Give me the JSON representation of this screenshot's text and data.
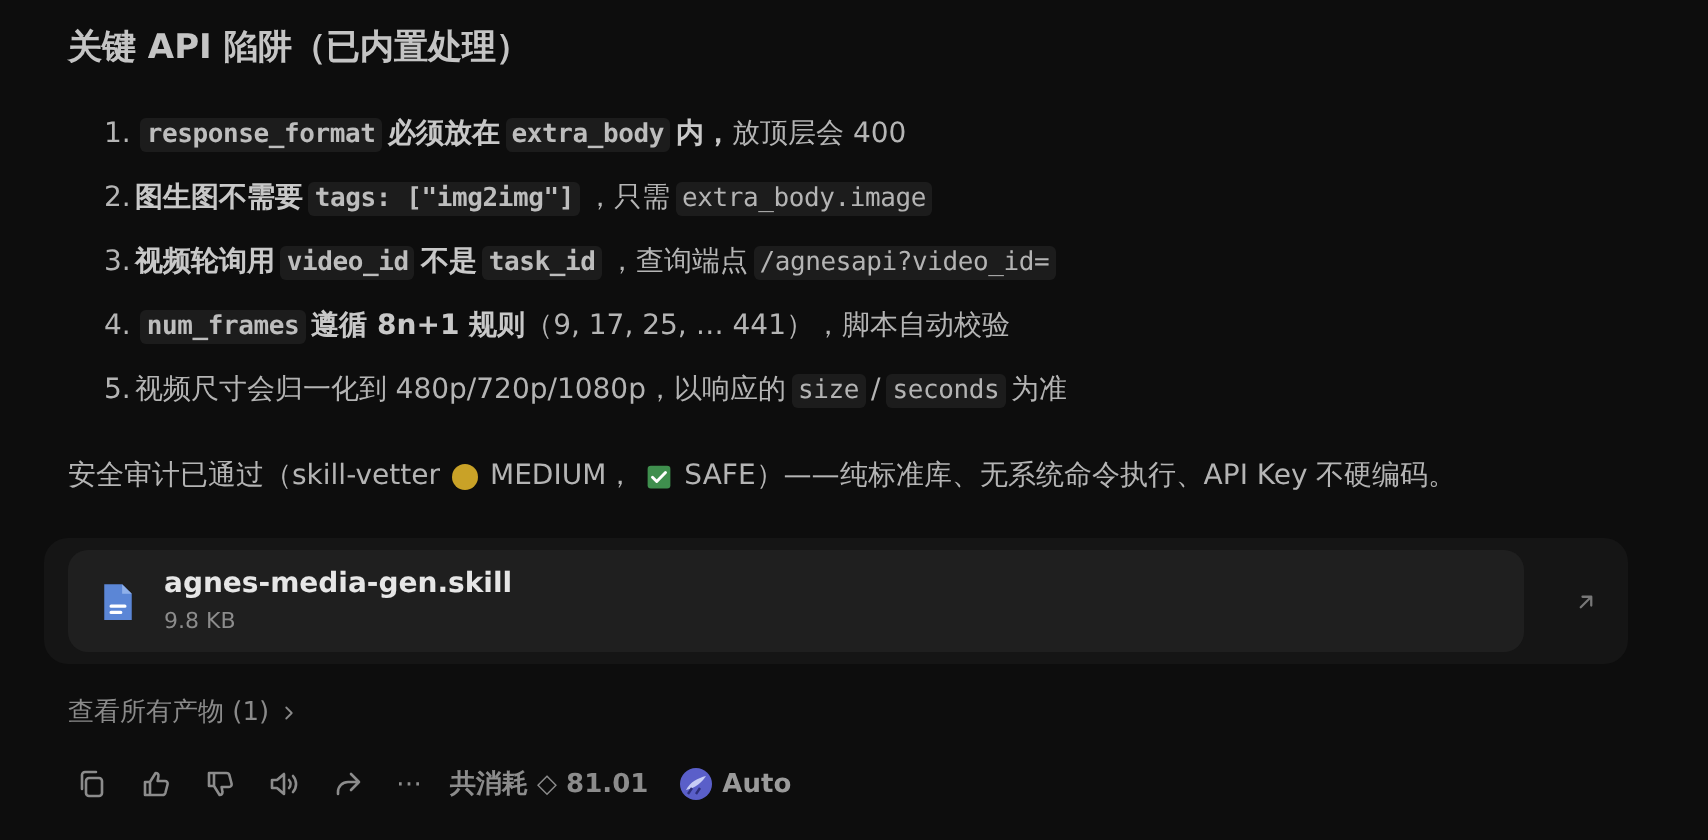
{
  "heading": "关键 API 陷阱（已内置处理）",
  "pitfalls": [
    {
      "number": "1.",
      "parts": [
        {
          "kind": "code",
          "text": "response_format",
          "bold": true
        },
        {
          "kind": "text",
          "text": "必须放在",
          "bold": true
        },
        {
          "kind": "code",
          "text": "extra_body",
          "bold": true
        },
        {
          "kind": "text",
          "text": "内，",
          "bold": true
        },
        {
          "kind": "text",
          "text": "放顶层会 400",
          "bold": false
        }
      ]
    },
    {
      "number": "2.",
      "parts": [
        {
          "kind": "text",
          "text": "图生图不需要",
          "bold": true
        },
        {
          "kind": "code",
          "text": "tags: [\"img2img\"]",
          "bold": true
        },
        {
          "kind": "text",
          "text": "，只需",
          "bold": false
        },
        {
          "kind": "code",
          "text": "extra_body.image",
          "bold": false
        }
      ]
    },
    {
      "number": "3.",
      "parts": [
        {
          "kind": "text",
          "text": "视频轮询用",
          "bold": true
        },
        {
          "kind": "code",
          "text": "video_id",
          "bold": true
        },
        {
          "kind": "text",
          "text": "不是",
          "bold": true
        },
        {
          "kind": "code",
          "text": "task_id",
          "bold": true
        },
        {
          "kind": "text",
          "text": "，查询端点",
          "bold": false
        },
        {
          "kind": "code",
          "text": "/agnesapi?video_id=",
          "bold": false
        }
      ]
    },
    {
      "number": "4.",
      "parts": [
        {
          "kind": "code",
          "text": "num_frames",
          "bold": true
        },
        {
          "kind": "text",
          "text": "遵循 8n+1 规则",
          "bold": true
        },
        {
          "kind": "text",
          "text": "（9, 17, 25, … 441），脚本自动校验",
          "bold": false
        }
      ]
    },
    {
      "number": "5.",
      "parts": [
        {
          "kind": "text",
          "text": "视频尺寸会归一化到 480p/720p/1080p，以响应的",
          "bold": false
        },
        {
          "kind": "code",
          "text": "size",
          "bold": false
        },
        {
          "kind": "text",
          "text": "/",
          "bold": false
        },
        {
          "kind": "code",
          "text": "seconds",
          "bold": false
        },
        {
          "kind": "text",
          "text": "为准",
          "bold": false
        }
      ]
    }
  ],
  "audit": [
    {
      "kind": "text",
      "text": "安全审计已通过（skill-vetter"
    },
    {
      "kind": "dot",
      "color": "#c9a227"
    },
    {
      "kind": "text",
      "text": "MEDIUM，"
    },
    {
      "kind": "check"
    },
    {
      "kind": "text",
      "text": "SAFE）——纯标准库、无系统命令执行、API Key 不硬编码。"
    }
  ],
  "file": {
    "name": "agnes-media-gen.skill",
    "size": "9.8 KB"
  },
  "view_all": "查看所有产物 (1)",
  "footer": {
    "more": "⋯",
    "cost": "共消耗 ◇ 81.01",
    "model": "Auto"
  }
}
